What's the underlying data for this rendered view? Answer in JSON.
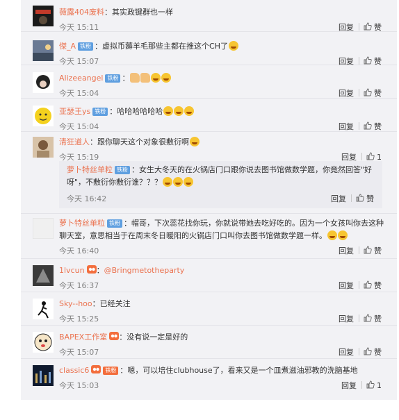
{
  "actions": {
    "reply": "回复",
    "like": "赞"
  },
  "comments": [
    {
      "user": "薇露404废料",
      "sep": "：",
      "text": "其实政键群也一样",
      "time": "今天 15:11",
      "like": "赞"
    },
    {
      "user": "傑_A",
      "badge": "铁粉",
      "sep": "：",
      "text": "虚拟币薅羊毛那些主都在推这个CH了",
      "time": "今天 15:07",
      "like": "赞"
    },
    {
      "user": "Alizeeangel",
      "badge": "铁粉",
      "sep": "：",
      "text": "",
      "time": "今天 15:04",
      "like": "赞"
    },
    {
      "user": "亚瑟王ys",
      "badge": "铁粉",
      "sep": "：",
      "text": "哈哈哈哈哈哈",
      "time": "今天 15:04",
      "like": "赞"
    },
    {
      "user": "清狂道人",
      "sep": "：",
      "text": "跟你聊天这个对象很敷衍啊",
      "time": "今天 15:19",
      "like": "1"
    },
    {
      "user": "萝卜特丝单粒",
      "badge": "铁粉",
      "sep": "：",
      "text_1": "帽哥，下次蕊花找你玩，你就说带她去吃好吃的。因为一个女孩叫你去这种",
      "text_2": "聊天室，意思相当于在周末冬日暖阳的火锅店门口叫你去图书馆做数学题一样。",
      "time": "今天 16:40",
      "like": "赞"
    },
    {
      "user": "1lvcun",
      "vip": true,
      "sep": "：",
      "text": "@Bringmetotheparty",
      "time": "今天 16:37",
      "like": "赞"
    },
    {
      "user": "Sky--hoo",
      "sep": "：",
      "text": "已经关注",
      "time": "今天 15:25",
      "like": "赞"
    },
    {
      "user": "BAPEX工作室",
      "vip": true,
      "sep": "：",
      "text": "没有说一定是好的",
      "time": "今天 15:07",
      "like": "赞"
    },
    {
      "user": "classic6",
      "vip": true,
      "badge": "铁粉",
      "sep": "：",
      "text": "嗯，可以培住clubhouse了，看来又是一个皿煮滋油邪教的洗脑基地",
      "time": "今天 15:03",
      "like": "1"
    }
  ],
  "nested_reply": {
    "user": "萝卜特丝单粒",
    "badge": "铁粉",
    "sep": "：",
    "text_1": "女生大冬天的在火锅店门口跟你说去图书馆做数学题，你竟然回答\"好",
    "text_2": "呀\"，不敷衍你敷衍谁？？？",
    "time": "今天 16:42",
    "like": "赞"
  }
}
